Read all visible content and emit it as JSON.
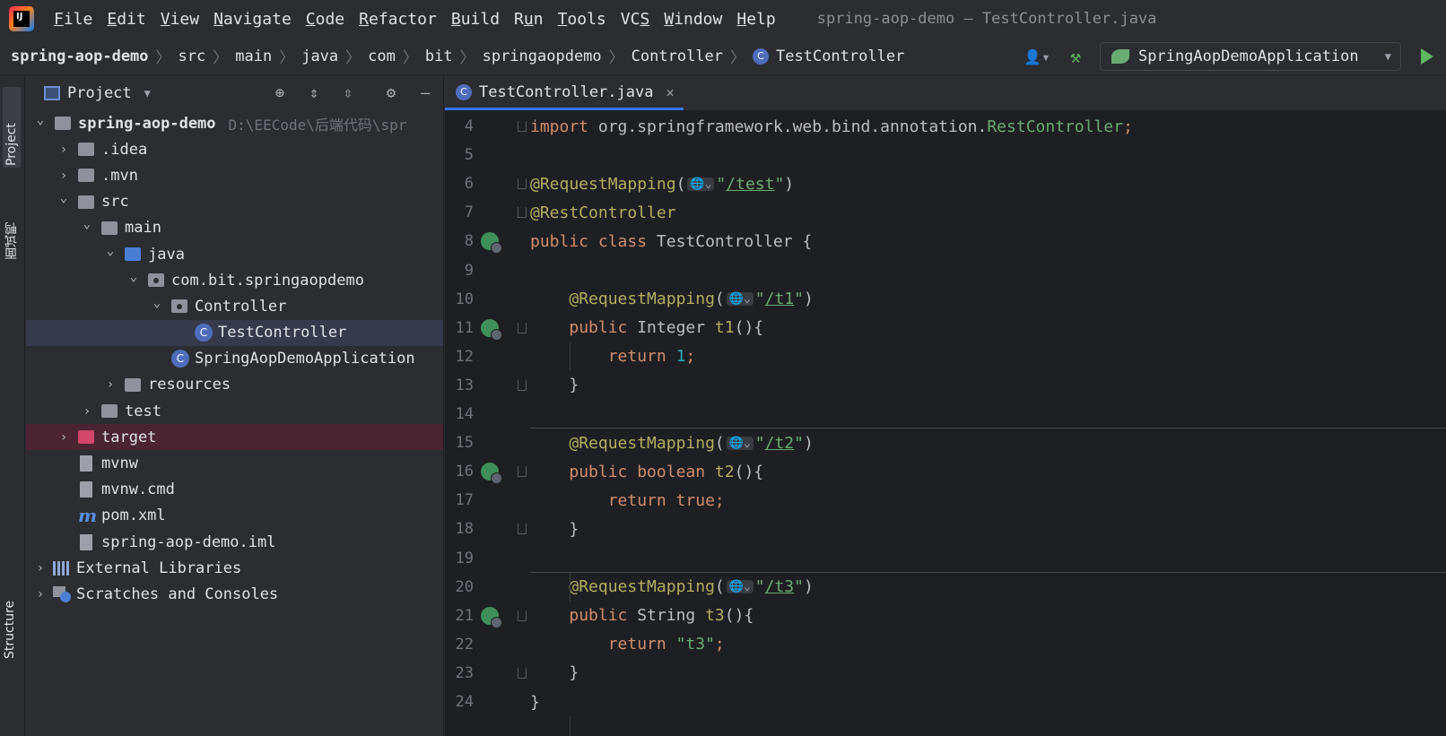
{
  "app": {
    "logo_text": "IJ",
    "window_title": "spring-aop-demo – TestController.java"
  },
  "menu": [
    {
      "label": "File",
      "mnemonic": "F",
      "rest": "ile"
    },
    {
      "label": "Edit",
      "mnemonic": "E",
      "rest": "dit"
    },
    {
      "label": "View",
      "mnemonic": "V",
      "rest": "iew"
    },
    {
      "label": "Navigate",
      "mnemonic": "N",
      "rest": "avigate"
    },
    {
      "label": "Code",
      "mnemonic": "C",
      "rest": "ode"
    },
    {
      "label": "Refactor",
      "mnemonic": "R",
      "rest": "efactor"
    },
    {
      "label": "Build",
      "mnemonic": "B",
      "rest": "uild"
    },
    {
      "label": "Run",
      "pre": "R",
      "mnemonic": "u",
      "rest": "n"
    },
    {
      "label": "Tools",
      "mnemonic": "T",
      "rest": "ools"
    },
    {
      "label": "VCS",
      "pre": "VC",
      "mnemonic": "S",
      "rest": ""
    },
    {
      "label": "Window",
      "mnemonic": "W",
      "rest": "indow"
    },
    {
      "label": "Help",
      "mnemonic": "H",
      "rest": "elp"
    }
  ],
  "breadcrumb": [
    "spring-aop-demo",
    "src",
    "main",
    "java",
    "com",
    "bit",
    "springaopdemo",
    "Controller",
    "TestController"
  ],
  "run_config": {
    "label": "SpringAopDemoApplication"
  },
  "side_tabs": {
    "project": "Project",
    "interview": "面试鸭",
    "structure": "Structure"
  },
  "project_panel": {
    "title": "Project",
    "tree": [
      {
        "label": "spring-aop-demo",
        "path": "D:\\EECode\\后端代码\\spr",
        "depth": 0,
        "expanded": true,
        "icon": "module",
        "bold": true
      },
      {
        "label": ".idea",
        "depth": 1,
        "expanded": false,
        "icon": "folder"
      },
      {
        "label": ".mvn",
        "depth": 1,
        "expanded": false,
        "icon": "folder"
      },
      {
        "label": "src",
        "depth": 1,
        "expanded": true,
        "icon": "folder"
      },
      {
        "label": "main",
        "depth": 2,
        "expanded": true,
        "icon": "folder"
      },
      {
        "label": "java",
        "depth": 3,
        "expanded": true,
        "icon": "folder-blue"
      },
      {
        "label": "com.bit.springaopdemo",
        "depth": 4,
        "expanded": true,
        "icon": "package"
      },
      {
        "label": "Controller",
        "depth": 5,
        "expanded": true,
        "icon": "package"
      },
      {
        "label": "TestController",
        "depth": 6,
        "icon": "class",
        "selected": true
      },
      {
        "label": "SpringAopDemoApplication",
        "depth": 5,
        "icon": "spring-class"
      },
      {
        "label": "resources",
        "depth": 3,
        "expanded": false,
        "icon": "folder"
      },
      {
        "label": "test",
        "depth": 2,
        "expanded": false,
        "icon": "folder"
      },
      {
        "label": "target",
        "depth": 1,
        "expanded": false,
        "icon": "folder-red",
        "excluded": true
      },
      {
        "label": "mvnw",
        "depth": 1,
        "icon": "file"
      },
      {
        "label": "mvnw.cmd",
        "depth": 1,
        "icon": "file"
      },
      {
        "label": "pom.xml",
        "depth": 1,
        "icon": "maven"
      },
      {
        "label": "spring-aop-demo.iml",
        "depth": 1,
        "icon": "file"
      },
      {
        "label": "External Libraries",
        "depth": 0,
        "expanded": false,
        "icon": "libraries"
      },
      {
        "label": "Scratches and Consoles",
        "depth": 0,
        "expanded": false,
        "icon": "scratches"
      }
    ]
  },
  "editor": {
    "tab": "TestController.java",
    "lines": [
      {
        "n": 4,
        "fold": true,
        "tokens": [
          [
            "kw",
            "import "
          ],
          [
            "typ",
            "org.springframework.web.bind.annotation."
          ],
          [
            "str",
            "RestController"
          ],
          [
            "kw",
            ";"
          ]
        ]
      },
      {
        "n": 5,
        "tokens": []
      },
      {
        "n": 6,
        "fold": true,
        "tokens": [
          [
            "ann",
            "@RequestMapping"
          ],
          [
            "typ",
            "("
          ],
          [
            "inlay",
            "🌐⌄"
          ],
          [
            "str",
            "\""
          ],
          [
            "url",
            "/test"
          ],
          [
            "str",
            "\""
          ],
          [
            "typ",
            ")"
          ]
        ]
      },
      {
        "n": 7,
        "fold": true,
        "tokens": [
          [
            "ann",
            "@RestController"
          ]
        ]
      },
      {
        "n": 8,
        "gutter": true,
        "tokens": [
          [
            "kw",
            "public class "
          ],
          [
            "typ",
            "TestController {"
          ]
        ]
      },
      {
        "n": 9,
        "tokens": []
      },
      {
        "n": 10,
        "tokens": [
          [
            "ind",
            "    "
          ],
          [
            "ann",
            "@RequestMapping"
          ],
          [
            "typ",
            "("
          ],
          [
            "inlay",
            "🌐⌄"
          ],
          [
            "str",
            "\""
          ],
          [
            "url",
            "/t1"
          ],
          [
            "str",
            "\""
          ],
          [
            "typ",
            ")"
          ]
        ]
      },
      {
        "n": 11,
        "gutter": true,
        "fold": true,
        "tokens": [
          [
            "ind",
            "    "
          ],
          [
            "kw",
            "public "
          ],
          [
            "typ",
            "Integer "
          ],
          [
            "ann",
            "t1"
          ],
          [
            "typ",
            "(){"
          ]
        ]
      },
      {
        "n": 12,
        "tokens": [
          [
            "ind",
            "        "
          ],
          [
            "kw",
            "return "
          ],
          [
            "num",
            "1"
          ],
          [
            "kw",
            ";"
          ]
        ]
      },
      {
        "n": 13,
        "fold": true,
        "tokens": [
          [
            "ind",
            "    "
          ],
          [
            "typ",
            "}"
          ]
        ]
      },
      {
        "n": 14,
        "tokens": []
      },
      {
        "n": 15,
        "divider": true,
        "tokens": [
          [
            "ind",
            "    "
          ],
          [
            "ann",
            "@RequestMapping"
          ],
          [
            "typ",
            "("
          ],
          [
            "inlay",
            "🌐⌄"
          ],
          [
            "str",
            "\""
          ],
          [
            "url",
            "/t2"
          ],
          [
            "str",
            "\""
          ],
          [
            "typ",
            ")"
          ]
        ]
      },
      {
        "n": 16,
        "gutter": true,
        "fold": true,
        "tokens": [
          [
            "ind",
            "    "
          ],
          [
            "kw",
            "public boolean "
          ],
          [
            "ann",
            "t2"
          ],
          [
            "typ",
            "(){"
          ]
        ]
      },
      {
        "n": 17,
        "tokens": [
          [
            "ind",
            "        "
          ],
          [
            "kw",
            "return true;"
          ]
        ]
      },
      {
        "n": 18,
        "fold": true,
        "tokens": [
          [
            "ind",
            "    "
          ],
          [
            "typ",
            "}"
          ]
        ]
      },
      {
        "n": 19,
        "tokens": []
      },
      {
        "n": 20,
        "divider": true,
        "tokens": [
          [
            "ind",
            "    "
          ],
          [
            "ann",
            "@RequestMapping"
          ],
          [
            "typ",
            "("
          ],
          [
            "inlay",
            "🌐⌄"
          ],
          [
            "str",
            "\""
          ],
          [
            "url",
            "/t3"
          ],
          [
            "str",
            "\""
          ],
          [
            "typ",
            ")"
          ]
        ]
      },
      {
        "n": 21,
        "gutter": true,
        "fold": true,
        "tokens": [
          [
            "ind",
            "    "
          ],
          [
            "kw",
            "public "
          ],
          [
            "typ",
            "String "
          ],
          [
            "ann",
            "t3"
          ],
          [
            "typ",
            "(){"
          ]
        ]
      },
      {
        "n": 22,
        "tokens": [
          [
            "ind",
            "        "
          ],
          [
            "kw",
            "return "
          ],
          [
            "str",
            "\"t3\""
          ],
          [
            "kw",
            ";"
          ]
        ]
      },
      {
        "n": 23,
        "fold": true,
        "tokens": [
          [
            "ind",
            "    "
          ],
          [
            "typ",
            "}"
          ]
        ]
      },
      {
        "n": 24,
        "tokens": [
          [
            "typ",
            "}"
          ]
        ]
      }
    ]
  }
}
